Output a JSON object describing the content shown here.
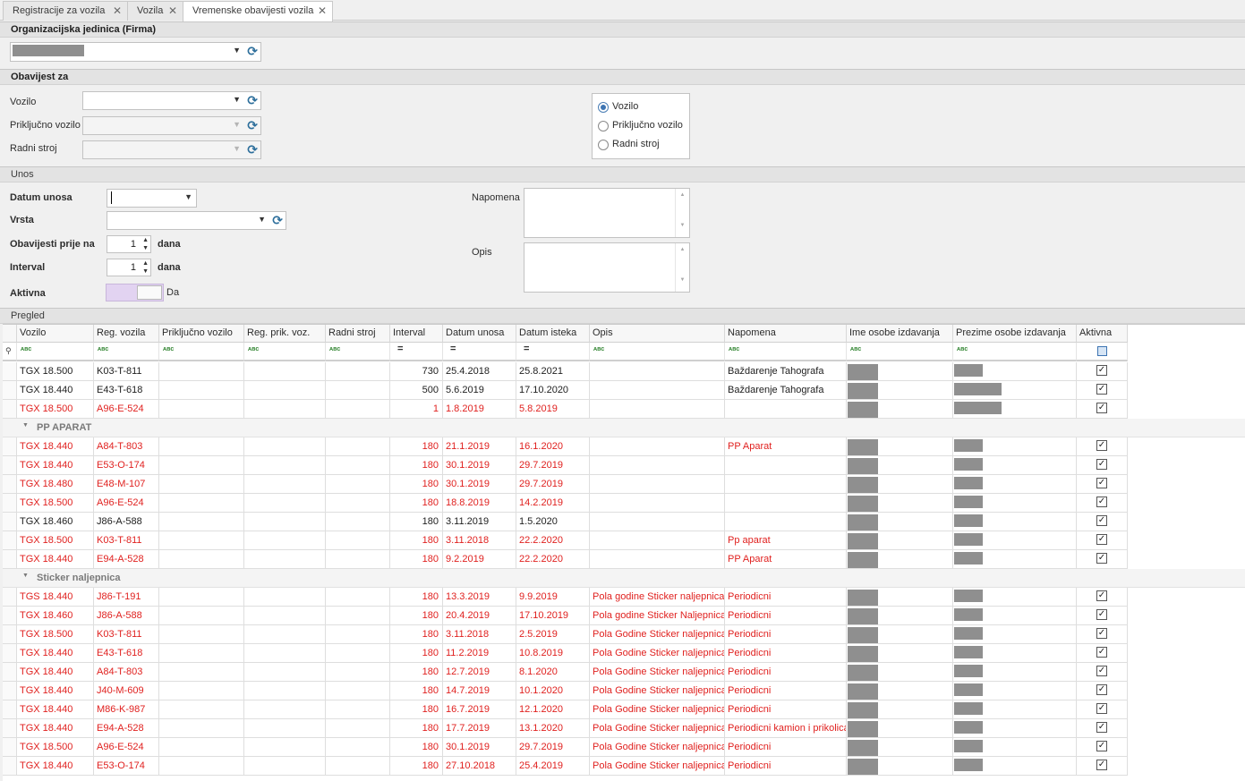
{
  "tabs": [
    {
      "label": "Registracije za vozila",
      "active": false
    },
    {
      "label": "Vozila",
      "active": false
    },
    {
      "label": "Vremenske obavijesti vozila",
      "active": true
    }
  ],
  "org": {
    "section_title": "Organizacijska jedinica (Firma)"
  },
  "notify": {
    "section_title": "Obavijest za",
    "vehicle_label": "Vozilo",
    "trailer_label": "Priključno vozilo",
    "machine_label": "Radni stroj",
    "radio_options": [
      "Vozilo",
      "Priključno vozilo",
      "Radni stroj"
    ],
    "radio_selected": "Vozilo"
  },
  "entry": {
    "section_title": "Unos",
    "date_label": "Datum unosa",
    "type_label": "Vrsta",
    "notify_before_label": "Obavijesti prije na",
    "notify_before_value": "1",
    "notify_before_unit": "dana",
    "interval_label": "Interval",
    "interval_value": "1",
    "interval_unit": "dana",
    "active_label": "Aktivna",
    "active_value": "Da",
    "note_label": "Napomena",
    "desc_label": "Opis"
  },
  "grid": {
    "section_title": "Pregled",
    "columns": [
      "Vozilo",
      "Reg. vozila",
      "Priključno vozilo",
      "Reg. prik. voz.",
      "Radni stroj",
      "Interval",
      "Datum unosa",
      "Datum isteka",
      "Opis",
      "Napomena",
      "Ime osobe izdavanja",
      "Prezime osobe izdavanja",
      "Aktivna"
    ],
    "filter_icons": [
      "abc-filter-icon",
      "equals-filter-icon",
      "checkbox-filter-icon"
    ],
    "rows": [
      {
        "kind": "data",
        "red": false,
        "vehicle": "TGX 18.500",
        "reg": "K03-T-811",
        "interval": "730",
        "date_in": "25.4.2018",
        "date_exp": "25.8.2021",
        "desc": "",
        "note": "Baždarenje Tahografa"
      },
      {
        "kind": "data",
        "red": false,
        "vehicle": "TGX 18.440",
        "reg": "E43-T-618",
        "interval": "500",
        "date_in": "5.6.2019",
        "date_exp": "17.10.2020",
        "desc": "",
        "note": "Baždarenje Tahografa"
      },
      {
        "kind": "data",
        "red": true,
        "vehicle": "TGX 18.500",
        "reg": "A96-E-524",
        "interval": "1",
        "date_in": "1.8.2019",
        "date_exp": "5.8.2019",
        "desc": "",
        "note": ""
      },
      {
        "kind": "group",
        "label": "PP APARAT"
      },
      {
        "kind": "data",
        "red": true,
        "vehicle": "TGX 18.440",
        "reg": "A84-T-803",
        "interval": "180",
        "date_in": "21.1.2019",
        "date_exp": "16.1.2020",
        "desc": "",
        "note": "PP Aparat"
      },
      {
        "kind": "data",
        "red": true,
        "vehicle": "TGX 18.440",
        "reg": "E53-O-174",
        "interval": "180",
        "date_in": "30.1.2019",
        "date_exp": "29.7.2019",
        "desc": "",
        "note": ""
      },
      {
        "kind": "data",
        "red": true,
        "vehicle": "TGX 18.480",
        "reg": "E48-M-107",
        "interval": "180",
        "date_in": "30.1.2019",
        "date_exp": "29.7.2019",
        "desc": "",
        "note": ""
      },
      {
        "kind": "data",
        "red": true,
        "vehicle": "TGX 18.500",
        "reg": "A96-E-524",
        "interval": "180",
        "date_in": "18.8.2019",
        "date_exp": "14.2.2019",
        "desc": "",
        "note": ""
      },
      {
        "kind": "data",
        "red": false,
        "vehicle": "TGX 18.460",
        "reg": "J86-A-588",
        "interval": "180",
        "date_in": "3.11.2019",
        "date_exp": "1.5.2020",
        "desc": "",
        "note": ""
      },
      {
        "kind": "data",
        "red": true,
        "vehicle": "TGX 18.500",
        "reg": "K03-T-811",
        "interval": "180",
        "date_in": "3.11.2018",
        "date_exp": "22.2.2020",
        "desc": "",
        "note": "Pp aparat"
      },
      {
        "kind": "data",
        "red": true,
        "vehicle": "TGX 18.440",
        "reg": "E94-A-528",
        "interval": "180",
        "date_in": "9.2.2019",
        "date_exp": "22.2.2020",
        "desc": "",
        "note": "PP Aparat"
      },
      {
        "kind": "group",
        "label": "Sticker naljepnica"
      },
      {
        "kind": "data",
        "red": true,
        "vehicle": "TGS 18.440",
        "reg": "J86-T-191",
        "interval": "180",
        "date_in": "13.3.2019",
        "date_exp": "9.9.2019",
        "desc": "Pola godine Sticker naljepnica",
        "note": "Periodicni"
      },
      {
        "kind": "data",
        "red": true,
        "vehicle": "TGX 18.460",
        "reg": "J86-A-588",
        "interval": "180",
        "date_in": "20.4.2019",
        "date_exp": "17.10.2019",
        "desc": "Pola godine Sticker Naljepnica",
        "note": "Periodicni"
      },
      {
        "kind": "data",
        "red": true,
        "vehicle": "TGX 18.500",
        "reg": "K03-T-811",
        "interval": "180",
        "date_in": "3.11.2018",
        "date_exp": "2.5.2019",
        "desc": "Pola Godine Sticker naljepnica",
        "note": "Periodicni"
      },
      {
        "kind": "data",
        "red": true,
        "vehicle": "TGX 18.440",
        "reg": "E43-T-618",
        "interval": "180",
        "date_in": "11.2.2019",
        "date_exp": "10.8.2019",
        "desc": "Pola Godine Sticker naljepnica",
        "note": "Periodicni"
      },
      {
        "kind": "data",
        "red": true,
        "vehicle": "TGX 18.440",
        "reg": "A84-T-803",
        "interval": "180",
        "date_in": "12.7.2019",
        "date_exp": "8.1.2020",
        "desc": "Pola Godine Sticker naljepnica",
        "note": "Periodicni"
      },
      {
        "kind": "data",
        "red": true,
        "vehicle": "TGX 18.440",
        "reg": "J40-M-609",
        "interval": "180",
        "date_in": "14.7.2019",
        "date_exp": "10.1.2020",
        "desc": "Pola Godine Sticker naljepnica",
        "note": "Periodicni"
      },
      {
        "kind": "data",
        "red": true,
        "vehicle": "TGX 18.440",
        "reg": "M86-K-987",
        "interval": "180",
        "date_in": "16.7.2019",
        "date_exp": "12.1.2020",
        "desc": "Pola Godine Sticker naljepnica",
        "note": "Periodicni"
      },
      {
        "kind": "data",
        "red": true,
        "vehicle": "TGX 18.440",
        "reg": "E94-A-528",
        "interval": "180",
        "date_in": "17.7.2019",
        "date_exp": "13.1.2020",
        "desc": "Pola Godine Sticker naljepnica",
        "note": "Periodicni kamion i prikolica"
      },
      {
        "kind": "data",
        "red": true,
        "vehicle": "TGX 18.500",
        "reg": "A96-E-524",
        "interval": "180",
        "date_in": "30.1.2019",
        "date_exp": "29.7.2019",
        "desc": "Pola Godine Sticker naljepnica",
        "note": "Periodicni"
      },
      {
        "kind": "data",
        "red": true,
        "vehicle": "TGX 18.440",
        "reg": "E53-O-174",
        "interval": "180",
        "date_in": "27.10.2018",
        "date_exp": "25.4.2019",
        "desc": "Pola Godine Sticker naljepnica",
        "note": "Periodicni"
      }
    ]
  },
  "colors": {
    "overdue_text": "#e0211f",
    "normal_text": "#1e1e1e",
    "toggle_on": "#e2d3f1",
    "radio_accent": "#3d74b2"
  }
}
